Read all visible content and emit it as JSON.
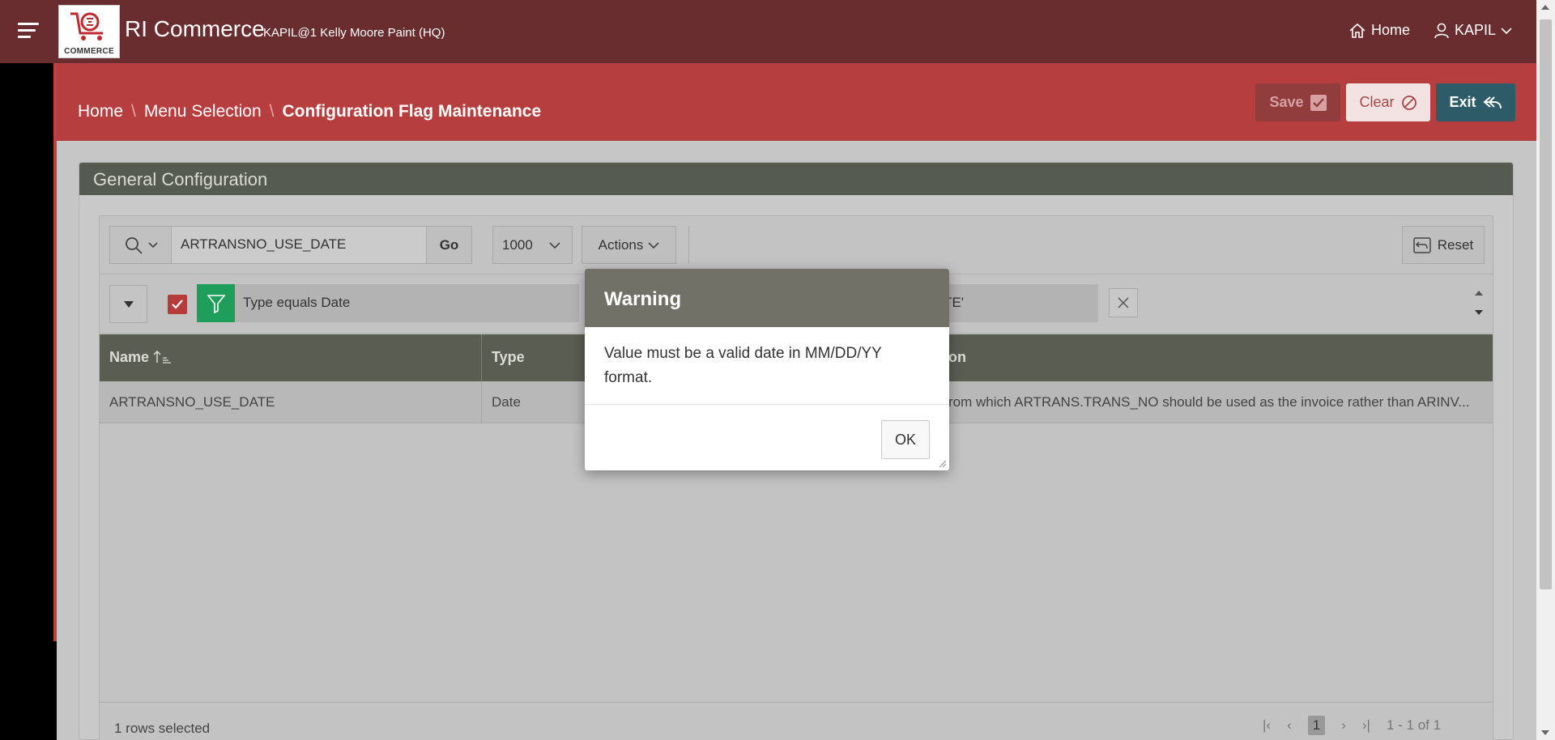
{
  "header": {
    "app_title": "RI Commerce",
    "app_subtitle": "KAPIL@1 Kelly Moore Paint (HQ)",
    "logo_text": "COMMERCE",
    "nav_home": "Home",
    "nav_user": "KAPIL"
  },
  "breadcrumb": {
    "items": [
      "Home",
      "Menu Selection",
      "Configuration Flag Maintenance"
    ]
  },
  "top_buttons": {
    "save": "Save",
    "clear": "Clear",
    "exit": "Exit"
  },
  "region": {
    "title": "General Configuration"
  },
  "toolbar": {
    "search_value": "ARTRANSNO_USE_DATE",
    "go": "Go",
    "rows": "1000",
    "actions": "Actions",
    "reset": "Reset"
  },
  "filter": {
    "text": "Type equals Date",
    "text2": "ATE'"
  },
  "grid": {
    "columns": [
      "Name",
      "Type",
      "on"
    ],
    "rows": [
      {
        "name": "ARTRANSNO_USE_DATE",
        "type": "Date",
        "description": "rom which ARTRANS.TRANS_NO should be used as the invoice rather than ARINV..."
      }
    ],
    "selected_text": "1 rows selected",
    "page": "1",
    "range": "1 - 1 of 1"
  },
  "dialog": {
    "title": "Warning",
    "message": "Value must be a valid date in MM/DD/YY format.",
    "ok": "OK"
  },
  "colors": {
    "header_bg": "#692d30",
    "title_band": "#b73e3f",
    "region_header": "#565b51",
    "dialog_header": "#717168",
    "exit_button": "#2e5b68",
    "filter_green": "#1f9e5b"
  }
}
